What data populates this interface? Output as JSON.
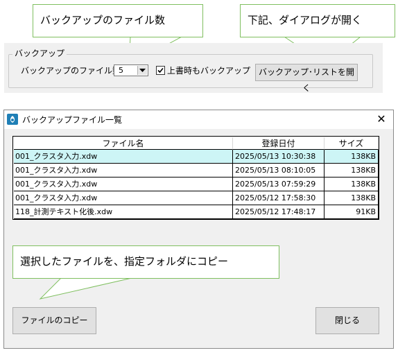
{
  "callouts": {
    "backup_count_note": "バックアップのファイル数",
    "open_list_note": "下記、ダイアログが開く",
    "copy_note": "選択したファイルを、指定フォルダにコピー"
  },
  "backup_settings": {
    "group_title": "バックアップ",
    "count_label": "バックアップのファイル数",
    "count_value": "5",
    "overwrite_checked": true,
    "overwrite_label": "上書時もバックアップ",
    "open_list_button": "バックアップ･リストを開く"
  },
  "dialog": {
    "title": "バックアップファイル一覧",
    "close_glyph": "✕",
    "columns": [
      "ファイル名",
      "登録日付",
      "サイズ"
    ],
    "rows": [
      {
        "name": "001_クラスタ入力.xdw",
        "date": "2025/05/13 10:30:38",
        "size": "138KB",
        "selected": true
      },
      {
        "name": "001_クラスタ入力.xdw",
        "date": "2025/05/13 08:10:05",
        "size": "138KB",
        "selected": false
      },
      {
        "name": "001_クラスタ入力.xdw",
        "date": "2025/05/13 07:59:29",
        "size": "138KB",
        "selected": false
      },
      {
        "name": "001_クラスタ入力.xdw",
        "date": "2025/05/12 17:58:30",
        "size": "138KB",
        "selected": false
      },
      {
        "name": "118_計測テキスト化後.xdw",
        "date": "2025/05/12 17:48:17",
        "size": "91KB",
        "selected": false
      }
    ],
    "copy_button": "ファイルのコピー",
    "close_button": "閉じる"
  },
  "icons": {
    "app": "app-logo-icon",
    "close": "close-icon",
    "dropdown": "chevron-down-icon",
    "check": "check-icon"
  },
  "colors": {
    "selected_row": "#cdf5f6",
    "callout_border": "#7fbf5f",
    "panel_bg": "#f0f0f0",
    "app_icon": "#1f7fb6"
  }
}
